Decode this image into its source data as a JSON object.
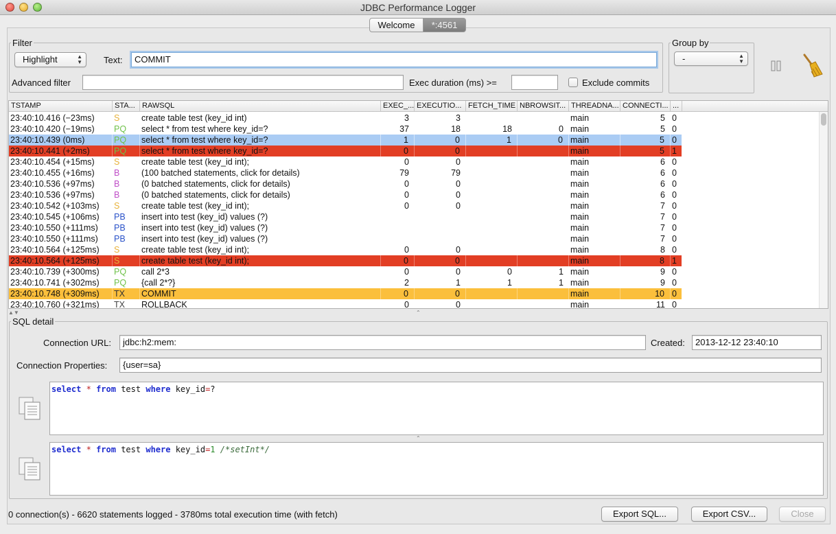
{
  "window": {
    "title": "JDBC Performance Logger"
  },
  "tabs": [
    {
      "label": "Welcome"
    },
    {
      "label": "*:4561"
    }
  ],
  "filter": {
    "legend": "Filter",
    "mode_value": "Highlight",
    "text_label": "Text:",
    "text_value": "COMMIT",
    "advanced_label": "Advanced filter",
    "advanced_value": "",
    "duration_label": "Exec duration (ms) >=",
    "duration_value": "",
    "exclude_label": "Exclude commits"
  },
  "group_by": {
    "legend": "Group by",
    "value": "-"
  },
  "table": {
    "columns": [
      "TSTAMP",
      "STA...",
      "RAWSQL",
      "EXEC_...",
      "EXECUTIO...",
      "FETCH_TIME",
      "NBROWSIT...",
      "THREADNA...",
      "CONNECTI...",
      "..."
    ],
    "rows": [
      {
        "ts": "23:40:10.416 (−23ms)",
        "st": "S",
        "sql": "create table test (key_id int)",
        "exec": "3",
        "execution": "3",
        "fetch": "",
        "nbrows": "",
        "thread": "main",
        "conn": "5",
        "err": "0",
        "hl": ""
      },
      {
        "ts": "23:40:10.420 (−19ms)",
        "st": "PQ",
        "sql": "select * from test where key_id=?",
        "exec": "37",
        "execution": "18",
        "fetch": "18",
        "nbrows": "0",
        "thread": "main",
        "conn": "5",
        "err": "0",
        "hl": ""
      },
      {
        "ts": "23:40:10.439 (0ms)",
        "st": "PQ",
        "sql": "select * from test where key_id=?",
        "exec": "1",
        "execution": "0",
        "fetch": "1",
        "nbrows": "0",
        "thread": "main",
        "conn": "5",
        "err": "0",
        "hl": "blue"
      },
      {
        "ts": "23:40:10.441 (+2ms)",
        "st": "PQ",
        "sql": "select * from test where key_id=?",
        "exec": "0",
        "execution": "0",
        "fetch": "",
        "nbrows": "",
        "thread": "main",
        "conn": "5",
        "err": "1",
        "hl": "red"
      },
      {
        "ts": "23:40:10.454 (+15ms)",
        "st": "S",
        "sql": "create table test (key_id int);",
        "exec": "0",
        "execution": "0",
        "fetch": "",
        "nbrows": "",
        "thread": "main",
        "conn": "6",
        "err": "0",
        "hl": ""
      },
      {
        "ts": "23:40:10.455 (+16ms)",
        "st": "B",
        "sql": "(100 batched statements, click for details)",
        "exec": "79",
        "execution": "79",
        "fetch": "",
        "nbrows": "",
        "thread": "main",
        "conn": "6",
        "err": "0",
        "hl": ""
      },
      {
        "ts": "23:40:10.536 (+97ms)",
        "st": "B",
        "sql": "(0 batched statements, click for details)",
        "exec": "0",
        "execution": "0",
        "fetch": "",
        "nbrows": "",
        "thread": "main",
        "conn": "6",
        "err": "0",
        "hl": ""
      },
      {
        "ts": "23:40:10.536 (+97ms)",
        "st": "B",
        "sql": "(0 batched statements, click for details)",
        "exec": "0",
        "execution": "0",
        "fetch": "",
        "nbrows": "",
        "thread": "main",
        "conn": "6",
        "err": "0",
        "hl": ""
      },
      {
        "ts": "23:40:10.542 (+103ms)",
        "st": "S",
        "sql": "create table test (key_id int);",
        "exec": "0",
        "execution": "0",
        "fetch": "",
        "nbrows": "",
        "thread": "main",
        "conn": "7",
        "err": "0",
        "hl": ""
      },
      {
        "ts": "23:40:10.545 (+106ms)",
        "st": "PB",
        "sql": "insert into test (key_id) values (?)",
        "exec": "",
        "execution": "",
        "fetch": "",
        "nbrows": "",
        "thread": "main",
        "conn": "7",
        "err": "0",
        "hl": ""
      },
      {
        "ts": "23:40:10.550 (+111ms)",
        "st": "PB",
        "sql": "insert into test (key_id) values (?)",
        "exec": "",
        "execution": "",
        "fetch": "",
        "nbrows": "",
        "thread": "main",
        "conn": "7",
        "err": "0",
        "hl": ""
      },
      {
        "ts": "23:40:10.550 (+111ms)",
        "st": "PB",
        "sql": "insert into test (key_id) values (?)",
        "exec": "",
        "execution": "",
        "fetch": "",
        "nbrows": "",
        "thread": "main",
        "conn": "7",
        "err": "0",
        "hl": ""
      },
      {
        "ts": "23:40:10.564 (+125ms)",
        "st": "S",
        "sql": "create table test (key_id int);",
        "exec": "0",
        "execution": "0",
        "fetch": "",
        "nbrows": "",
        "thread": "main",
        "conn": "8",
        "err": "0",
        "hl": ""
      },
      {
        "ts": "23:40:10.564 (+125ms)",
        "st": "S",
        "sql": "create table test (key_id int);",
        "exec": "0",
        "execution": "0",
        "fetch": "",
        "nbrows": "",
        "thread": "main",
        "conn": "8",
        "err": "1",
        "hl": "red"
      },
      {
        "ts": "23:40:10.739 (+300ms)",
        "st": "PQ",
        "sql": "call 2*3",
        "exec": "0",
        "execution": "0",
        "fetch": "0",
        "nbrows": "1",
        "thread": "main",
        "conn": "9",
        "err": "0",
        "hl": ""
      },
      {
        "ts": "23:40:10.741 (+302ms)",
        "st": "PQ",
        "sql": "{call 2*?}",
        "exec": "2",
        "execution": "1",
        "fetch": "1",
        "nbrows": "1",
        "thread": "main",
        "conn": "9",
        "err": "0",
        "hl": ""
      },
      {
        "ts": "23:40:10.748 (+309ms)",
        "st": "TX",
        "sql": "COMMIT",
        "exec": "0",
        "execution": "0",
        "fetch": "",
        "nbrows": "",
        "thread": "main",
        "conn": "10",
        "err": "0",
        "hl": "orange"
      },
      {
        "ts": "23:40:10.760 (+321ms)",
        "st": "TX",
        "sql": "ROLLBACK",
        "exec": "0",
        "execution": "0",
        "fetch": "",
        "nbrows": "",
        "thread": "main",
        "conn": "11",
        "err": "0",
        "hl": ""
      }
    ]
  },
  "status_colors": {
    "S": "#e8b23a",
    "PQ": "#6fc24a",
    "B": "#c04fc8",
    "PB": "#2a52c9",
    "TX": "#444444"
  },
  "highlight_colors": {
    "blue": "#aaccf4",
    "red": "#e23e24",
    "orange": "#fbbf3c"
  },
  "detail": {
    "legend": "SQL detail",
    "conn_url_label": "Connection URL:",
    "conn_url_value": "jdbc:h2:mem:",
    "created_label": "Created:",
    "created_value": "2013-12-12 23:40:10",
    "conn_props_label": "Connection Properties:",
    "conn_props_value": "{user=sa}",
    "raw_sql": "select * from test where key_id=?",
    "filled_sql": "select * from test where key_id=1 /*setInt*/"
  },
  "footer": {
    "status": "0 connection(s) - 6620 statements logged - 3780ms total execution time (with fetch)",
    "export_sql": "Export SQL...",
    "export_csv": "Export CSV...",
    "close": "Close"
  }
}
